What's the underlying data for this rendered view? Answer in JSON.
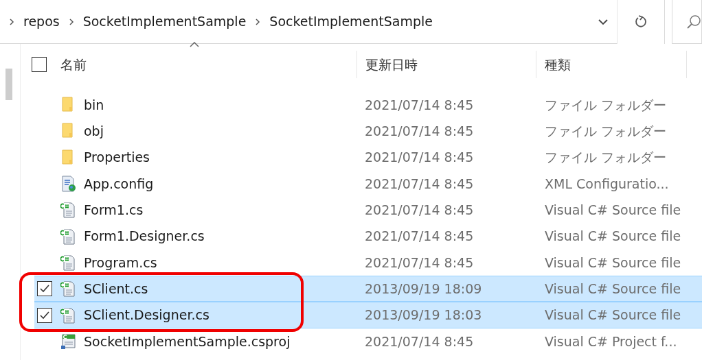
{
  "address_bar": {
    "breadcrumbs": [
      "repos",
      "SocketImplementSample",
      "SocketImplementSample"
    ]
  },
  "header": {
    "checkbox": {
      "checked": false
    },
    "columns": [
      {
        "label": "名前",
        "sorted": true
      },
      {
        "label": "更新日時",
        "sorted": false
      },
      {
        "label": "種類",
        "sorted": false
      }
    ]
  },
  "rows": [
    {
      "kind": "folder",
      "name": "bin",
      "date": "2021/07/14 8:45",
      "type": "ファイル フォルダー",
      "checked": false,
      "selected": false,
      "annotated": false
    },
    {
      "kind": "folder",
      "name": "obj",
      "date": "2021/07/14 8:45",
      "type": "ファイル フォルダー",
      "checked": false,
      "selected": false,
      "annotated": false
    },
    {
      "kind": "folder",
      "name": "Properties",
      "date": "2021/07/14 8:45",
      "type": "ファイル フォルダー",
      "checked": false,
      "selected": false,
      "annotated": false
    },
    {
      "kind": "config",
      "name": "App.config",
      "date": "2021/07/14 8:45",
      "type": "XML Configuratio...",
      "checked": false,
      "selected": false,
      "annotated": false
    },
    {
      "kind": "cs",
      "name": "Form1.cs",
      "date": "2021/07/14 8:45",
      "type": "Visual C# Source file",
      "checked": false,
      "selected": false,
      "annotated": false
    },
    {
      "kind": "cs",
      "name": "Form1.Designer.cs",
      "date": "2021/07/14 8:45",
      "type": "Visual C# Source file",
      "checked": false,
      "selected": false,
      "annotated": false
    },
    {
      "kind": "cs",
      "name": "Program.cs",
      "date": "2021/07/14 8:45",
      "type": "Visual C# Source file",
      "checked": false,
      "selected": false,
      "annotated": false
    },
    {
      "kind": "cs",
      "name": "SClient.cs",
      "date": "2013/09/19 18:09",
      "type": "Visual C# Source file",
      "checked": true,
      "selected": true,
      "annotated": true
    },
    {
      "kind": "cs",
      "name": "SClient.Designer.cs",
      "date": "2013/09/19 18:03",
      "type": "Visual C# Source file",
      "checked": true,
      "selected": true,
      "annotated": true
    },
    {
      "kind": "csproj",
      "name": "SocketImplementSample.csproj",
      "date": "2021/07/14 8:45",
      "type": "Visual C# Project f...",
      "checked": false,
      "selected": false,
      "annotated": false
    }
  ]
}
